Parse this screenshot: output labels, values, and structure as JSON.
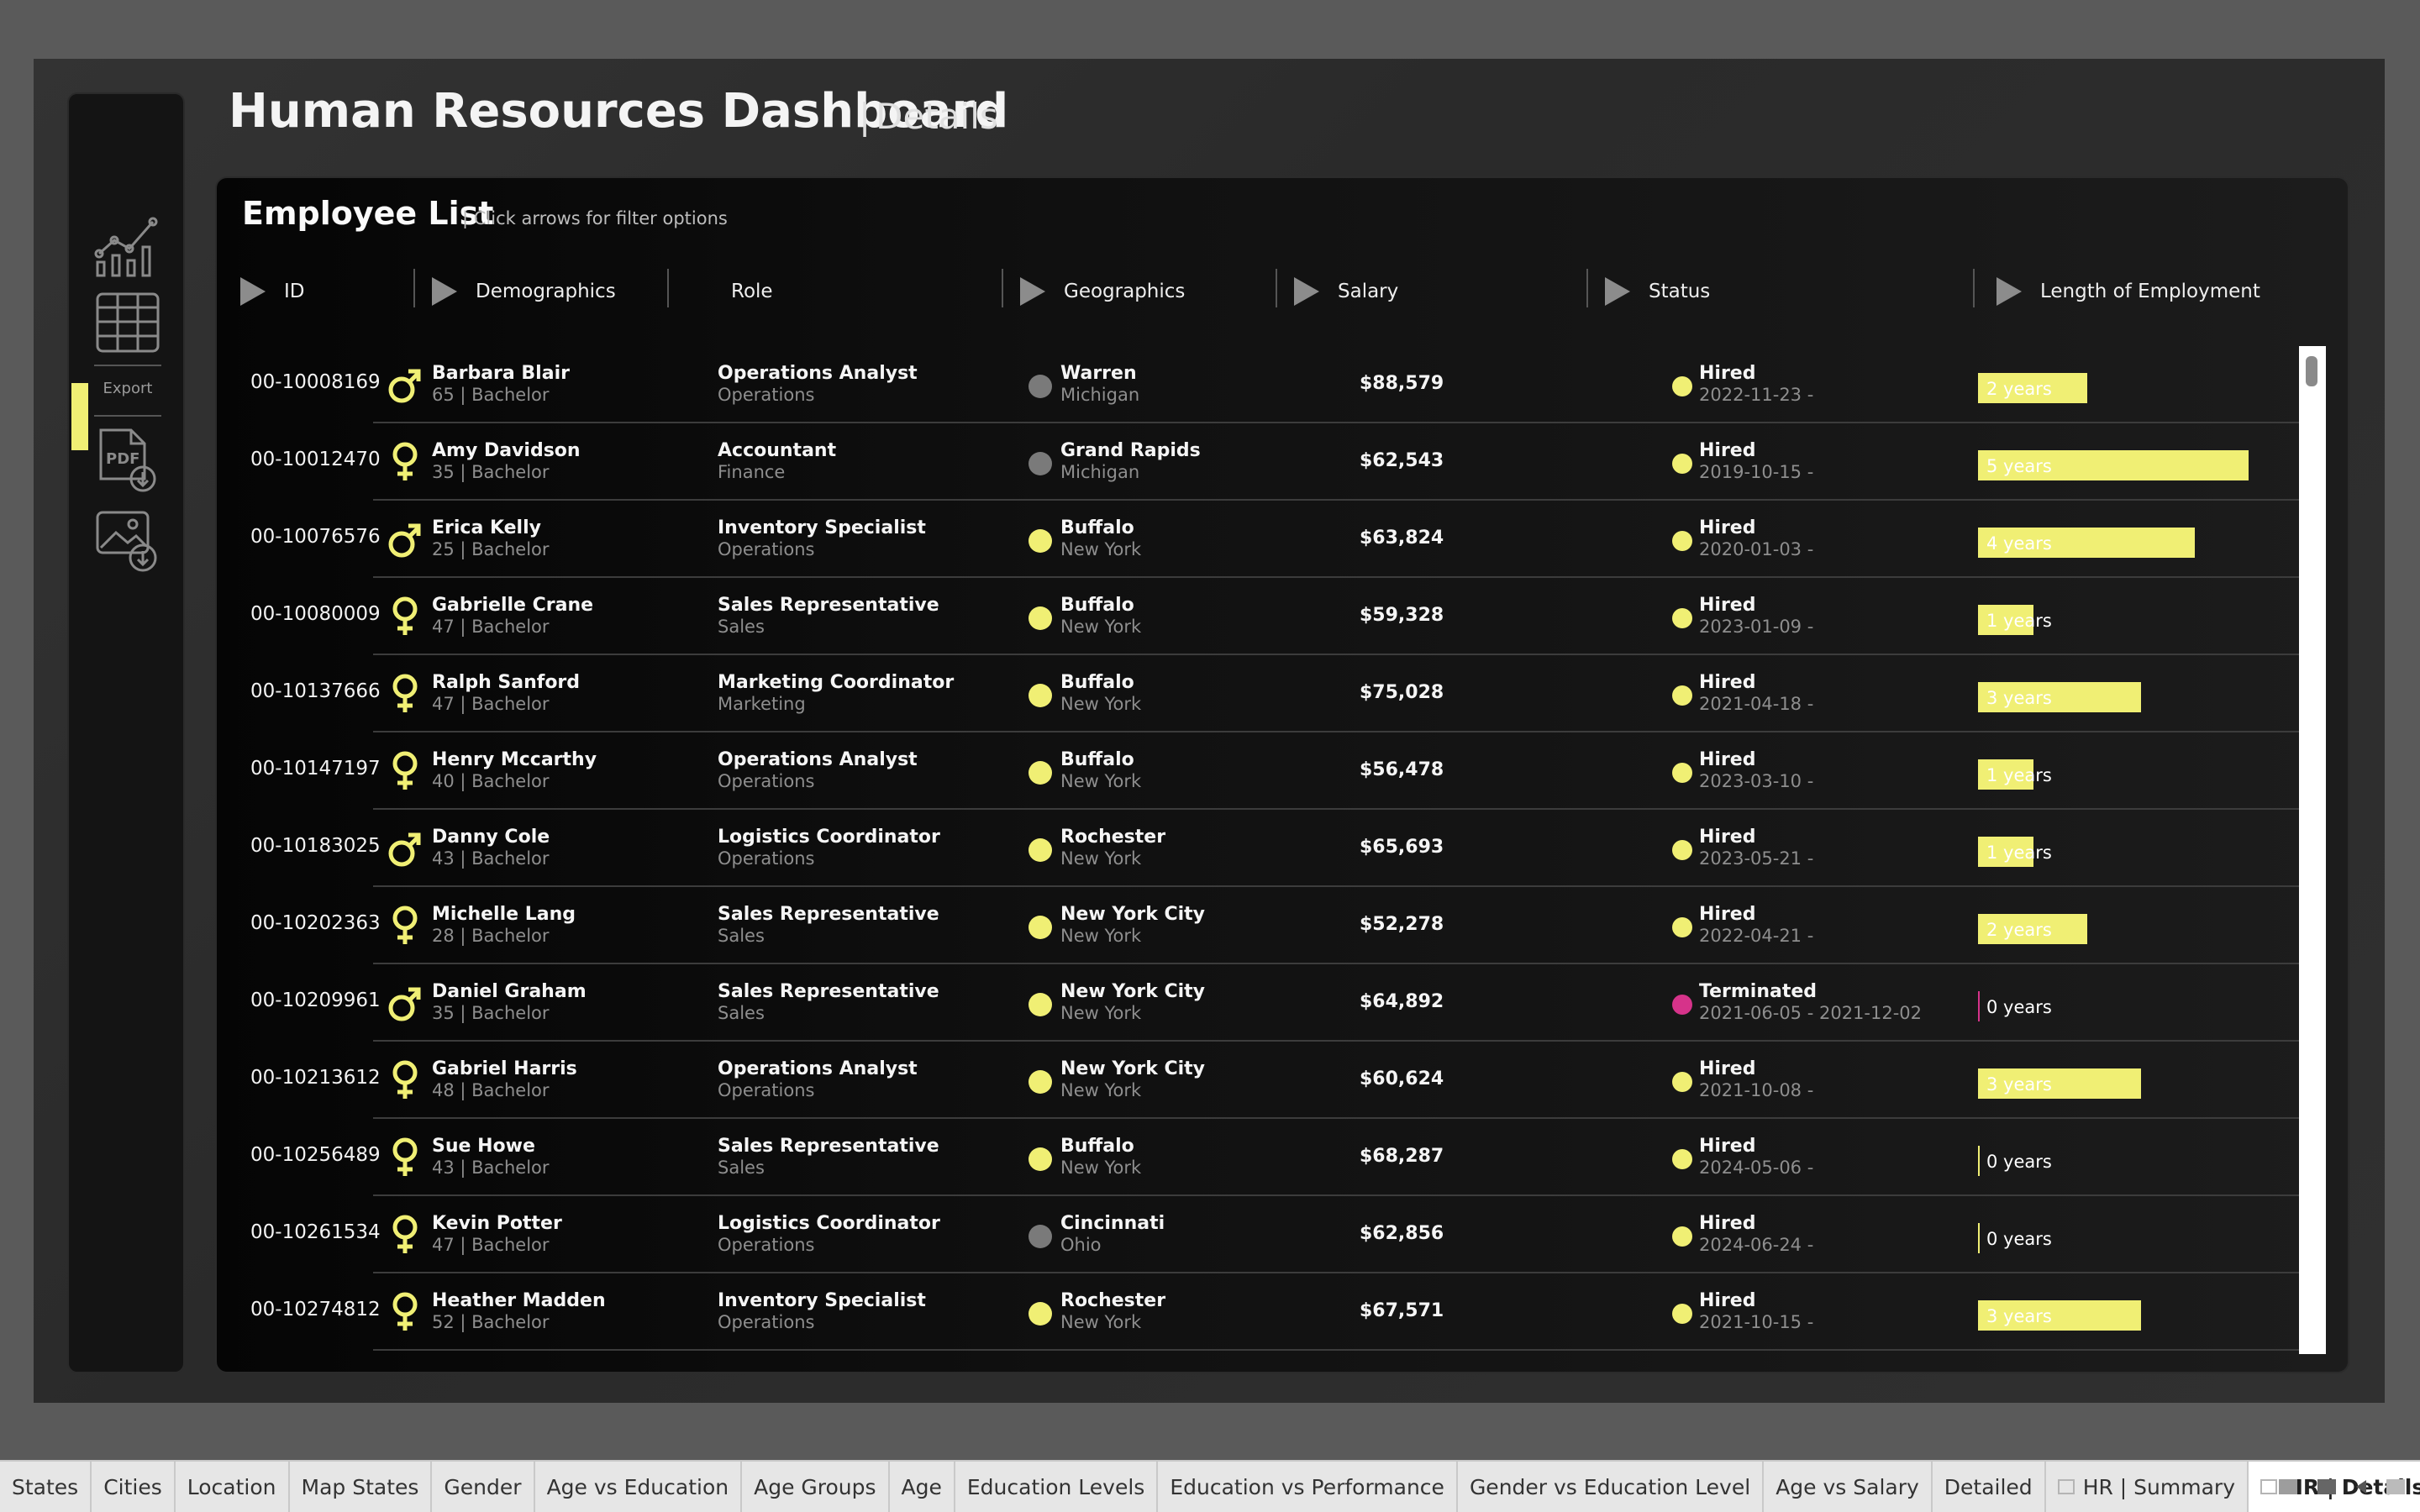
{
  "header": {
    "title": "Human Resources Dashboard",
    "subtitle_pipe": "|",
    "subtitle": "Details"
  },
  "sidebar": {
    "items": [
      {
        "icon": "line-chart-icon"
      },
      {
        "icon": "table-icon"
      },
      {
        "icon": "pdf-export-icon"
      },
      {
        "icon": "image-export-icon"
      }
    ],
    "export_label": "Export"
  },
  "panel": {
    "title": "Employee List",
    "hint": "| Click arrows for filter options"
  },
  "columns": {
    "id": "ID",
    "demographics": "Demographics",
    "role": "Role",
    "geographics": "Geographics",
    "salary": "Salary",
    "status": "Status",
    "length": "Length of Employment"
  },
  "colors": {
    "accent": "#f0ef74",
    "terminated": "#d6338a",
    "geo_gray": "#7a7a7a",
    "tab_active_bg": "#ffffff"
  },
  "rows": [
    {
      "id": "00-10008169",
      "gender": "male",
      "name": "Barbara Blair",
      "demo": "65 | Bachelor",
      "role": "Operations Analyst",
      "dept": "Operations",
      "city": "Warren",
      "state": "Michigan",
      "geo_color": "gray",
      "salary": "$88,579",
      "status": "Hired",
      "dates": "2022-11-23 -",
      "years": 2,
      "years_label": "2 years"
    },
    {
      "id": "00-10012470",
      "gender": "female",
      "name": "Amy Davidson",
      "demo": "35 | Bachelor",
      "role": "Accountant",
      "dept": "Finance",
      "city": "Grand Rapids",
      "state": "Michigan",
      "geo_color": "gray",
      "salary": "$62,543",
      "status": "Hired",
      "dates": "2019-10-15 -",
      "years": 5,
      "years_label": "5 years"
    },
    {
      "id": "00-10076576",
      "gender": "male",
      "name": "Erica Kelly",
      "demo": "25 | Bachelor",
      "role": "Inventory Specialist",
      "dept": "Operations",
      "city": "Buffalo",
      "state": "New York",
      "geo_color": "yellow",
      "salary": "$63,824",
      "status": "Hired",
      "dates": "2020-01-03 -",
      "years": 4,
      "years_label": "4 years"
    },
    {
      "id": "00-10080009",
      "gender": "female",
      "name": "Gabrielle Crane",
      "demo": "47 | Bachelor",
      "role": "Sales Representative",
      "dept": "Sales",
      "city": "Buffalo",
      "state": "New York",
      "geo_color": "yellow",
      "salary": "$59,328",
      "status": "Hired",
      "dates": "2023-01-09 -",
      "years": 1,
      "years_label": "1 years"
    },
    {
      "id": "00-10137666",
      "gender": "female",
      "name": "Ralph Sanford",
      "demo": "47 | Bachelor",
      "role": "Marketing Coordinator",
      "dept": "Marketing",
      "city": "Buffalo",
      "state": "New York",
      "geo_color": "yellow",
      "salary": "$75,028",
      "status": "Hired",
      "dates": "2021-04-18 -",
      "years": 3,
      "years_label": "3 years"
    },
    {
      "id": "00-10147197",
      "gender": "female",
      "name": "Henry Mccarthy",
      "demo": "40 | Bachelor",
      "role": "Operations Analyst",
      "dept": "Operations",
      "city": "Buffalo",
      "state": "New York",
      "geo_color": "yellow",
      "salary": "$56,478",
      "status": "Hired",
      "dates": "2023-03-10 -",
      "years": 1,
      "years_label": "1 years"
    },
    {
      "id": "00-10183025",
      "gender": "male",
      "name": "Danny Cole",
      "demo": "43 | Bachelor",
      "role": "Logistics Coordinator",
      "dept": "Operations",
      "city": "Rochester",
      "state": "New York",
      "geo_color": "yellow",
      "salary": "$65,693",
      "status": "Hired",
      "dates": "2023-05-21 -",
      "years": 1,
      "years_label": "1 years"
    },
    {
      "id": "00-10202363",
      "gender": "female",
      "name": "Michelle Lang",
      "demo": "28 | Bachelor",
      "role": "Sales Representative",
      "dept": "Sales",
      "city": "New York City",
      "state": "New York",
      "geo_color": "yellow",
      "salary": "$52,278",
      "status": "Hired",
      "dates": "2022-04-21 -",
      "years": 2,
      "years_label": "2 years"
    },
    {
      "id": "00-10209961",
      "gender": "male",
      "name": "Daniel Graham",
      "demo": "35 | Bachelor",
      "role": "Sales Representative",
      "dept": "Sales",
      "city": "New York City",
      "state": "New York",
      "geo_color": "yellow",
      "salary": "$64,892",
      "status": "Terminated",
      "dates": "2021-06-05 - 2021-12-02",
      "years": 0,
      "years_label": "0 years"
    },
    {
      "id": "00-10213612",
      "gender": "female",
      "name": "Gabriel Harris",
      "demo": "48 | Bachelor",
      "role": "Operations Analyst",
      "dept": "Operations",
      "city": "New York City",
      "state": "New York",
      "geo_color": "yellow",
      "salary": "$60,624",
      "status": "Hired",
      "dates": "2021-10-08 -",
      "years": 3,
      "years_label": "3 years"
    },
    {
      "id": "00-10256489",
      "gender": "female",
      "name": "Sue Howe",
      "demo": "43 | Bachelor",
      "role": "Sales Representative",
      "dept": "Sales",
      "city": "Buffalo",
      "state": "New York",
      "geo_color": "yellow",
      "salary": "$68,287",
      "status": "Hired",
      "dates": "2024-05-06 -",
      "years": 0,
      "years_label": "0 years"
    },
    {
      "id": "00-10261534",
      "gender": "female",
      "name": "Kevin Potter",
      "demo": "47 | Bachelor",
      "role": "Logistics Coordinator",
      "dept": "Operations",
      "city": "Cincinnati",
      "state": "Ohio",
      "geo_color": "gray",
      "salary": "$62,856",
      "status": "Hired",
      "dates": "2024-06-24 -",
      "years": 0,
      "years_label": "0 years"
    },
    {
      "id": "00-10274812",
      "gender": "female",
      "name": "Heather Madden",
      "demo": "52 | Bachelor",
      "role": "Inventory Specialist",
      "dept": "Operations",
      "city": "Rochester",
      "state": "New York",
      "geo_color": "yellow",
      "salary": "$67,571",
      "status": "Hired",
      "dates": "2021-10-15 -",
      "years": 3,
      "years_label": "3 years"
    }
  ],
  "tabs": [
    {
      "label": "States"
    },
    {
      "label": "Cities"
    },
    {
      "label": "Location"
    },
    {
      "label": "Map States"
    },
    {
      "label": "Gender"
    },
    {
      "label": "Age vs Education"
    },
    {
      "label": "Age Groups"
    },
    {
      "label": "Age"
    },
    {
      "label": "Education Levels"
    },
    {
      "label": "Education vs Performance"
    },
    {
      "label": "Gender vs Education Level"
    },
    {
      "label": "Age vs Salary"
    },
    {
      "label": "Detailed"
    },
    {
      "label": "HR | Summary",
      "icon": true
    },
    {
      "label": "HR | Details",
      "icon": true,
      "active": true
    }
  ]
}
